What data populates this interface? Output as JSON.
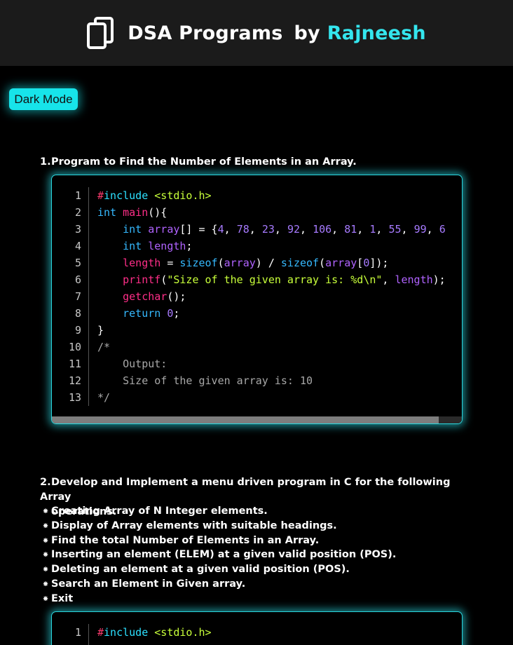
{
  "header": {
    "title": "DSA Programs",
    "by": "by",
    "author": "Rajneesh",
    "icon": "copy-icon"
  },
  "mode_button": {
    "label": "Dark Mode"
  },
  "program1": {
    "number": "1.",
    "title": "Program to Find the Number of Elements in an Array.",
    "line_numbers": [
      "1",
      "2",
      "3",
      "4",
      "5",
      "6",
      "7",
      "8",
      "9",
      "10",
      "11",
      "12",
      "13"
    ],
    "code": {
      "l1_pre": "#",
      "l1_inc": "include",
      "l1_hdr": "<stdio.h>",
      "l2_type": "int",
      "l2_fn": "main",
      "l2_rest": "(){",
      "l3_type": "int",
      "l3_var": "array",
      "l3_op": "[] = {",
      "l3_n1": "4",
      "l3_n2": "78",
      "l3_n3": "23",
      "l3_n4": "92",
      "l3_n5": "106",
      "l3_n6": "81",
      "l3_n7": "1",
      "l3_n8": "55",
      "l3_n9": "99",
      "l3_n10": "6",
      "l4_type": "int",
      "l4_var": "length",
      "l4_end": ";",
      "l5_var": "length",
      "l5_eq": " = ",
      "l5_fn1": "sizeof",
      "l5_p1": "(",
      "l5_var2": "array",
      "l5_div": ") / ",
      "l5_fn2": "sizeof",
      "l5_p2": "(",
      "l5_var3": "array",
      "l5_b1": "[",
      "l5_zero": "0",
      "l5_end": "]);",
      "l6_fn": "printf",
      "l6_p": "(",
      "l6_str": "\"Size of the given array is: %d\\n\"",
      "l6_comma": ", ",
      "l6_var": "length",
      "l6_end": ");",
      "l7_fn": "getchar",
      "l7_end": "();",
      "l8_kw": "return",
      "l8_num": "0",
      "l8_end": ";",
      "l9": "}",
      "l10": "/*",
      "l11": "Output:",
      "l12": "Size of the given array is: 10",
      "l13": "*/"
    }
  },
  "program2": {
    "number": "2.",
    "title": "Develop and Implement a menu driven program in C for the following Array",
    "title_cont": "operations.",
    "bullet_mark": "⁕",
    "bullets": [
      "Creating Array of N Integer elements.",
      "Display of Array elements with suitable headings.",
      "Find the total Number of Elements in an Array.",
      "Inserting an element (ELEM) at a given valid position (POS).",
      "Deleting an element at a given valid position (POS).",
      "Search an Element in Given array.",
      "Exit"
    ],
    "code": {
      "l1_pre": "#",
      "l1_inc": "include",
      "l1_hdr": "<stdio.h>"
    }
  },
  "colors": {
    "accent": "#17e4ea",
    "header_bg": "#1b1b1b",
    "page_bg": "#000000"
  }
}
